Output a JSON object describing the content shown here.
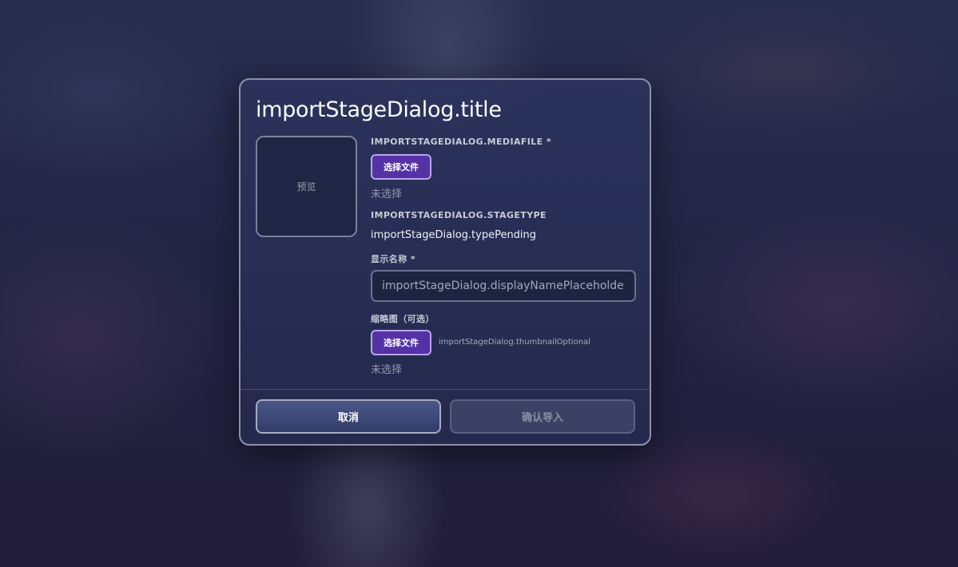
{
  "dialog": {
    "title": "importStageDialog.title",
    "preview_label": "预览",
    "media_file": {
      "label": "IMPORTSTAGEDIALOG.MEDIAFILE *",
      "button_label": "选择文件",
      "status": "未选择"
    },
    "stage_type": {
      "label": "IMPORTSTAGEDIALOG.STAGETYPE",
      "value": "importStageDialog.typePending"
    },
    "display_name": {
      "label": "显示名称 *",
      "placeholder": "importStageDialog.displayNamePlaceholder",
      "value": ""
    },
    "thumbnail": {
      "label": "缩略图（可选）",
      "button_label": "选择文件",
      "hint": "importStageDialog.thumbnailOptional",
      "status": "未选择"
    },
    "footer": {
      "cancel_label": "取消",
      "confirm_label": "确认导入",
      "confirm_enabled": false
    }
  },
  "colors": {
    "accent": "#5531a6",
    "dialog_border": "#8c90ab",
    "dialog_background": "#2c335c"
  }
}
